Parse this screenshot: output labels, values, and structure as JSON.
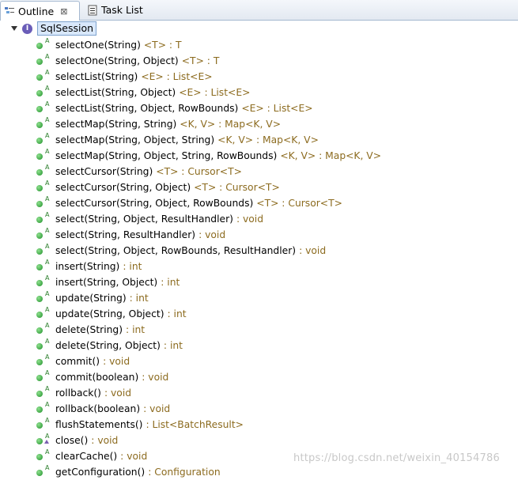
{
  "tabs": [
    {
      "label": "Outline",
      "close": "⊠"
    },
    {
      "label": "Task List"
    }
  ],
  "root": {
    "label": "SqlSession",
    "icon_letter": "I"
  },
  "methods": [
    {
      "sig": "selectOne(String)",
      "ret": "<T> : T"
    },
    {
      "sig": "selectOne(String, Object)",
      "ret": "<T> : T"
    },
    {
      "sig": "selectList(String)",
      "ret": "<E> : List<E>"
    },
    {
      "sig": "selectList(String, Object)",
      "ret": "<E> : List<E>"
    },
    {
      "sig": "selectList(String, Object, RowBounds)",
      "ret": "<E> : List<E>"
    },
    {
      "sig": "selectMap(String, String)",
      "ret": "<K, V> : Map<K, V>"
    },
    {
      "sig": "selectMap(String, Object, String)",
      "ret": "<K, V> : Map<K, V>"
    },
    {
      "sig": "selectMap(String, Object, String, RowBounds)",
      "ret": "<K, V> : Map<K, V>"
    },
    {
      "sig": "selectCursor(String)",
      "ret": "<T> : Cursor<T>"
    },
    {
      "sig": "selectCursor(String, Object)",
      "ret": "<T> : Cursor<T>"
    },
    {
      "sig": "selectCursor(String, Object, RowBounds)",
      "ret": "<T> : Cursor<T>"
    },
    {
      "sig": "select(String, Object, ResultHandler)",
      "ret": ": void"
    },
    {
      "sig": "select(String, ResultHandler)",
      "ret": ": void"
    },
    {
      "sig": "select(String, Object, RowBounds, ResultHandler)",
      "ret": ": void"
    },
    {
      "sig": "insert(String)",
      "ret": ": int"
    },
    {
      "sig": "insert(String, Object)",
      "ret": ": int"
    },
    {
      "sig": "update(String)",
      "ret": ": int"
    },
    {
      "sig": "update(String, Object)",
      "ret": ": int"
    },
    {
      "sig": "delete(String)",
      "ret": ": int"
    },
    {
      "sig": "delete(String, Object)",
      "ret": ": int"
    },
    {
      "sig": "commit()",
      "ret": ": void"
    },
    {
      "sig": "commit(boolean)",
      "ret": ": void"
    },
    {
      "sig": "rollback()",
      "ret": ": void"
    },
    {
      "sig": "rollback(boolean)",
      "ret": ": void"
    },
    {
      "sig": "flushStatements()",
      "ret": ": List<BatchResult>"
    },
    {
      "sig": "close()",
      "ret": ": void",
      "default": true
    },
    {
      "sig": "clearCache()",
      "ret": ": void"
    },
    {
      "sig": "getConfiguration()",
      "ret": ": Configuration"
    }
  ],
  "watermark": "https://blog.csdn.net/weixin_40154786",
  "colors": {
    "return_type": "#8c6b1f",
    "method_dot": "#1f8f2a",
    "selection": "#d9e8fb"
  }
}
